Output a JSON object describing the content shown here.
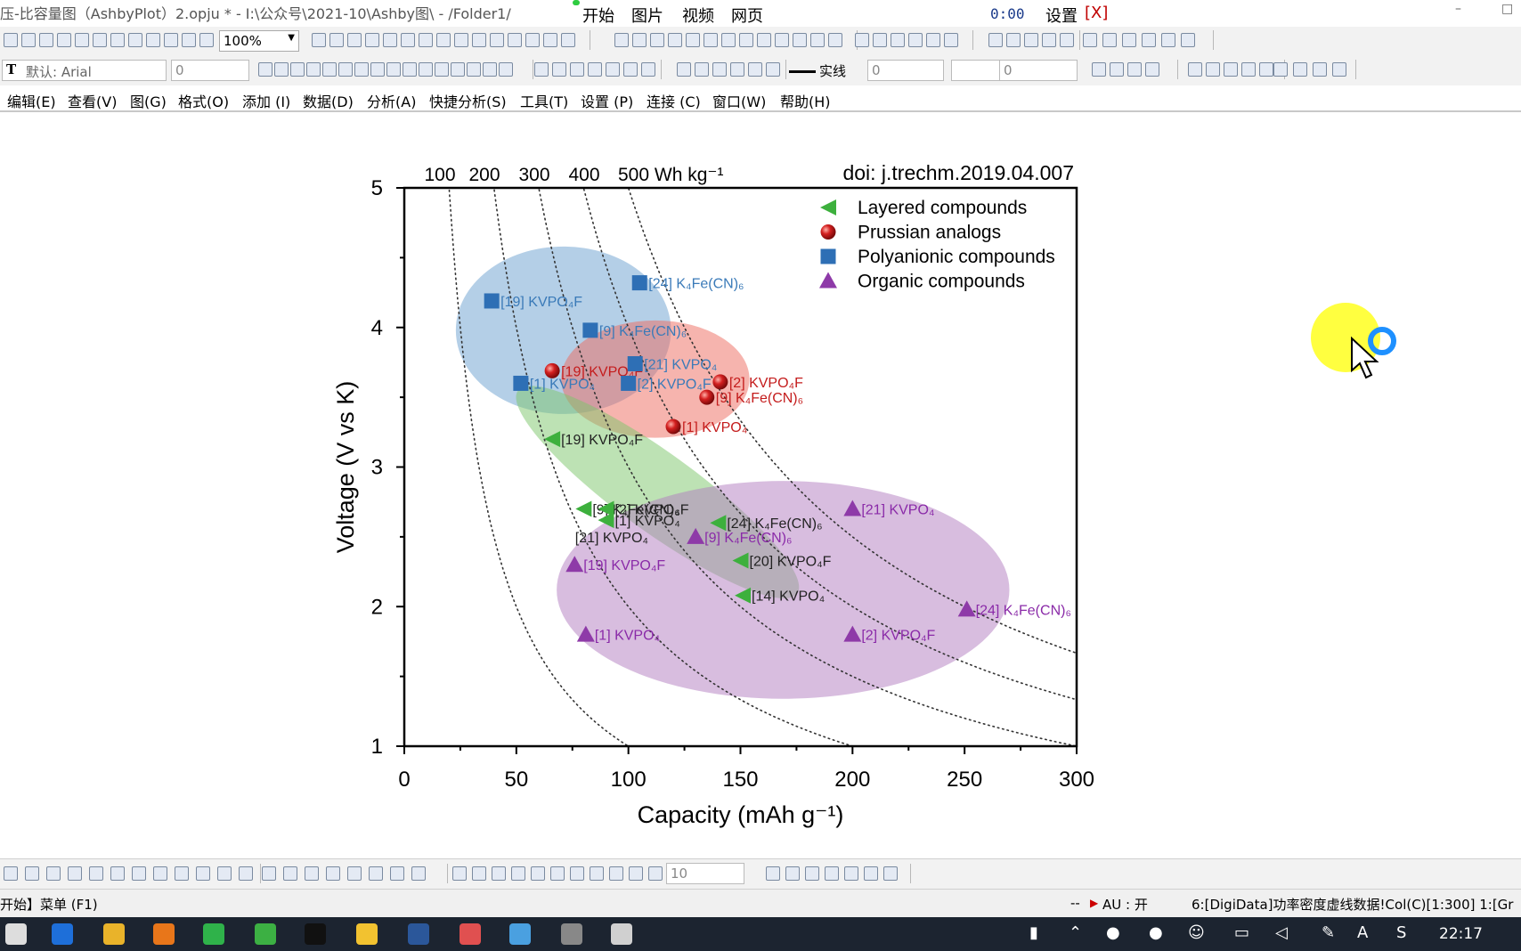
{
  "window": {
    "title": "压-比容量图（AshbyPlot）2.opju * - I:\\公众号\\2021-10\\Ashby图\\ - /Folder1/",
    "media_buttons": [
      "开始",
      "图片",
      "视频",
      "网页"
    ],
    "timer": "0:00",
    "settings_label": "设置",
    "close_label": "[X]"
  },
  "toolbar": {
    "zoom": "100%",
    "font_name": "默认: Arial",
    "font_size": "0",
    "line_style": "实线",
    "line_width": "0",
    "line_extra": "0",
    "plot_size": "10"
  },
  "menu": [
    "编辑(E)",
    "查看(V)",
    "图(G)",
    "格式(O)",
    "添加 (I)",
    "数据(D)",
    "分析(A)",
    "快捷分析(S)",
    "工具(T)",
    "设置 (P)",
    "连接 (C)",
    "窗口(W)",
    "帮助(H)"
  ],
  "status": {
    "left": "开始】菜单 (F1)",
    "mid": "-- ",
    "au": "AU : 开",
    "right": "6:[DigiData]功率密度虚线数据!Col(C)[1:300]  1:[Gr"
  },
  "taskbar": {
    "time": "22:17"
  },
  "colors": {
    "layered": "#3db03d",
    "prussian": "#d42020",
    "polyanionic": "#2e6fb5",
    "organic": "#8e3aa8",
    "ellipse_blue": "#6a9fcf",
    "ellipse_red": "#ee6a5e",
    "ellipse_green": "#7cc56a",
    "ellipse_purple": "#b27cc0"
  },
  "chart_data": {
    "type": "scatter",
    "doi": "doi: j.trechm.2019.04.007",
    "xlabel": "Capacity (mAh g⁻¹)",
    "ylabel": "Voltage (V vs K)",
    "xlim": [
      0,
      300
    ],
    "ylim": [
      1,
      5
    ],
    "x_ticks": [
      "0",
      "50",
      "100",
      "150",
      "200",
      "250",
      "300"
    ],
    "y_ticks": [
      "1",
      "2",
      "3",
      "4",
      "5"
    ],
    "energy_curves": [
      100,
      200,
      300,
      400,
      500
    ],
    "energy_labels": [
      "100",
      "200",
      "300",
      "400",
      "500 Wh kg⁻¹"
    ],
    "legend": [
      "Layered compounds",
      "Prussian analogs",
      "Polyanionic compounds",
      "Organic compounds"
    ],
    "legend_position": "top-right",
    "series": [
      {
        "name": "Layered compounds",
        "marker": "triangle-left",
        "points": [
          {
            "x": 66,
            "y": 3.2,
            "label": "[19] KVPO₄F"
          },
          {
            "x": 80,
            "y": 2.7,
            "label": "[9] K₄Fe(CN)₆"
          },
          {
            "x": 90,
            "y": 2.7,
            "label": "[2] KVPO₄F"
          },
          {
            "x": 90,
            "y": 2.62,
            "label": "[1] KVPO₄"
          },
          {
            "x": 140,
            "y": 2.6,
            "label": "[24] K₄Fe(CN)₆"
          },
          {
            "x": 150,
            "y": 2.33,
            "label": "[20] KVPO₄F"
          },
          {
            "x": 151,
            "y": 2.08,
            "label": "[14] KVPO₄"
          }
        ]
      },
      {
        "name": "Prussian analogs",
        "marker": "sphere",
        "points": [
          {
            "x": 66,
            "y": 3.69,
            "label": "[19] KVPO₄F"
          },
          {
            "x": 141,
            "y": 3.61,
            "label": "[2] KVPO₄F"
          },
          {
            "x": 135,
            "y": 3.5,
            "label": "[9] K₄Fe(CN)₆"
          },
          {
            "x": 120,
            "y": 3.29,
            "label": "[1] KVPO₄"
          }
        ]
      },
      {
        "name": "Polyanionic compounds",
        "marker": "square",
        "points": [
          {
            "x": 39,
            "y": 4.19,
            "label": "[19] KVPO₄F"
          },
          {
            "x": 105,
            "y": 4.32,
            "label": "[24] K₄Fe(CN)₆"
          },
          {
            "x": 83,
            "y": 3.98,
            "label": "[9] K₄Fe(CN)₆"
          },
          {
            "x": 103,
            "y": 3.74,
            "label": "[21] KVPO₄"
          },
          {
            "x": 52,
            "y": 3.6,
            "label": "[1] KVPO₄"
          },
          {
            "x": 100,
            "y": 3.6,
            "label": "[2] KVPO₄F"
          }
        ]
      },
      {
        "name": "Organic compounds",
        "marker": "triangle-up",
        "points": [
          {
            "x": 200,
            "y": 2.7,
            "label": "[21] KVPO₄"
          },
          {
            "x": 130,
            "y": 2.5,
            "label": "[9] K₄Fe(CN)₆"
          },
          {
            "x": 76,
            "y": 2.3,
            "label": "[19] KVPO₄F"
          },
          {
            "x": 251,
            "y": 1.98,
            "label": "[24] K₄Fe(CN)₆"
          },
          {
            "x": 81,
            "y": 1.8,
            "label": "[1] KVPO₄"
          },
          {
            "x": 200,
            "y": 1.8,
            "label": "[2] KVPO₄F"
          }
        ]
      }
    ],
    "extra_labels": [
      {
        "x": 108,
        "y": 2.5,
        "text": "[21] KVPO₄",
        "series": "Layered compounds"
      }
    ],
    "ellipses": [
      {
        "series": "Polyanionic compounds",
        "cx": 71,
        "cy": 3.98,
        "rx": 48,
        "ry": 0.6,
        "angle": 0
      },
      {
        "series": "Prussian analogs",
        "cx": 112,
        "cy": 3.63,
        "rx": 42,
        "ry": 0.42,
        "angle": 0
      },
      {
        "series": "Layered compounds",
        "cx": 113,
        "cy": 2.82,
        "rx": 77,
        "ry": 0.28,
        "angle": 36
      },
      {
        "series": "Organic compounds",
        "cx": 169,
        "cy": 2.12,
        "rx": 101,
        "ry": 0.78,
        "angle": 0
      }
    ]
  }
}
